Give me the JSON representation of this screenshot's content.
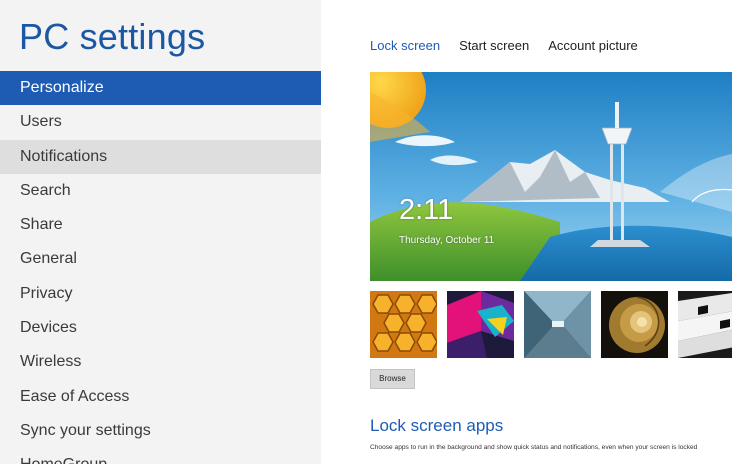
{
  "sidebar": {
    "title": "PC settings",
    "items": [
      {
        "label": "Personalize",
        "state": "selected"
      },
      {
        "label": "Users",
        "state": "normal"
      },
      {
        "label": "Notifications",
        "state": "hover"
      },
      {
        "label": "Search",
        "state": "normal"
      },
      {
        "label": "Share",
        "state": "normal"
      },
      {
        "label": "General",
        "state": "normal"
      },
      {
        "label": "Privacy",
        "state": "normal"
      },
      {
        "label": "Devices",
        "state": "normal"
      },
      {
        "label": "Wireless",
        "state": "normal"
      },
      {
        "label": "Ease of Access",
        "state": "normal"
      },
      {
        "label": "Sync your settings",
        "state": "normal"
      },
      {
        "label": "HomeGroup",
        "state": "normal"
      }
    ]
  },
  "main": {
    "tabs": [
      {
        "label": "Lock screen",
        "active": true
      },
      {
        "label": "Start screen",
        "active": false
      },
      {
        "label": "Account picture",
        "active": false
      }
    ],
    "preview": {
      "time": "2:11",
      "date": "Thursday, October 11"
    },
    "thumbnails": [
      {
        "name": "honeycomb"
      },
      {
        "name": "geometric-shapes"
      },
      {
        "name": "tunnel"
      },
      {
        "name": "nautilus-shell"
      },
      {
        "name": "piano-keys"
      }
    ],
    "browse_label": "Browse",
    "lock_apps": {
      "title": "Lock screen apps",
      "description": "Choose apps to run in the background and show quick status and notifications, even when your screen is locked"
    }
  },
  "colors": {
    "accent": "#1e5cb3",
    "title": "#1c57a4",
    "sidebar_bg": "#f3f3f3",
    "hover_bg": "#dedede"
  }
}
